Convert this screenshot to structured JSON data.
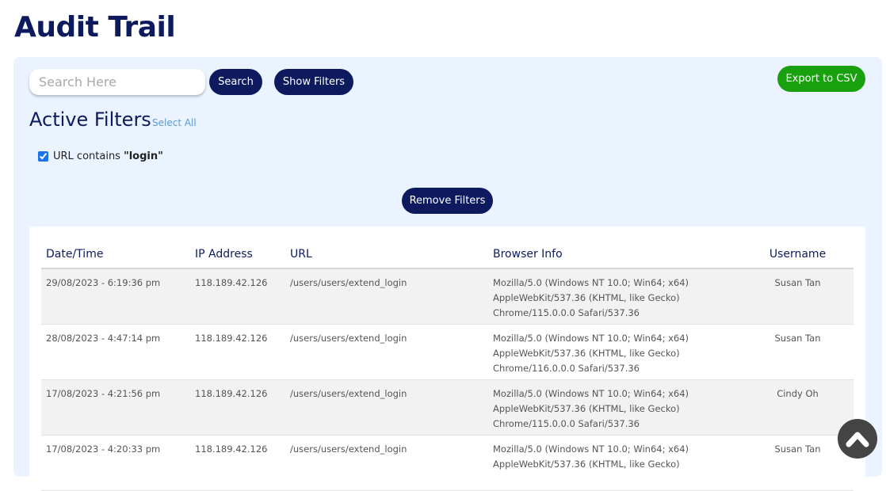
{
  "page": {
    "title": "Audit Trail"
  },
  "toolbar": {
    "search_placeholder": "Search Here",
    "search_label": "Search",
    "show_filters_label": "Show Filters",
    "export_label": "Export to CSV"
  },
  "filters": {
    "title": "Active Filters",
    "select_all_label": "Select All",
    "items": [
      {
        "label": "URL contains",
        "value": "\"login\"",
        "checked": true
      }
    ],
    "remove_label": "Remove Filters"
  },
  "table": {
    "columns": [
      "Date/Time",
      "IP Address",
      "URL",
      "Browser Info",
      "Username"
    ],
    "rows": [
      {
        "datetime": "29/08/2023 - 6:19:36 pm",
        "ip": "118.189.42.126",
        "url": "/users/users/extend_login",
        "browser": "Mozilla/5.0 (Windows NT 10.0; Win64; x64)\nAppleWebKit/537.36 (KHTML, like Gecko)\nChrome/115.0.0.0 Safari/537.36",
        "username": "Susan Tan"
      },
      {
        "datetime": "28/08/2023 - 4:47:14 pm",
        "ip": "118.189.42.126",
        "url": "/users/users/extend_login",
        "browser": "Mozilla/5.0 (Windows NT 10.0; Win64; x64)\nAppleWebKit/537.36 (KHTML, like Gecko)\nChrome/116.0.0.0 Safari/537.36",
        "username": "Susan Tan"
      },
      {
        "datetime": "17/08/2023 - 4:21:56 pm",
        "ip": "118.189.42.126",
        "url": "/users/users/extend_login",
        "browser": "Mozilla/5.0 (Windows NT 10.0; Win64; x64)\nAppleWebKit/537.36 (KHTML, like Gecko)\nChrome/115.0.0.0 Safari/537.36",
        "username": "Cindy Oh"
      },
      {
        "datetime": "17/08/2023 - 4:20:33 pm",
        "ip": "118.189.42.126",
        "url": "/users/users/extend_login",
        "browser": "Mozilla/5.0 (Windows NT 10.0; Win64; x64)\nAppleWebKit/537.36 (KHTML, like Gecko)",
        "username": "Susan Tan"
      }
    ]
  },
  "icons": {
    "scroll_top": "chevron-up-icon"
  },
  "colors": {
    "navy": "#0d1b5e",
    "export_green": "#18a00e",
    "panel_bg": "#eaf3ff",
    "link_blue": "#5a9ad6"
  }
}
